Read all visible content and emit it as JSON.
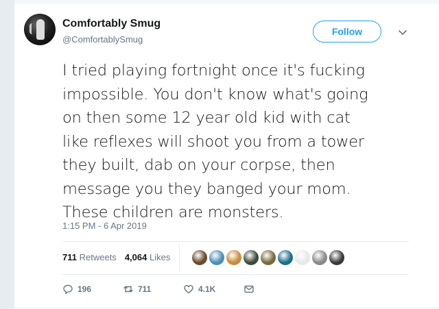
{
  "tweet": {
    "author": {
      "name": "Comfortably Smug",
      "handle": "@ComfortablySmug"
    },
    "follow_label": "Follow",
    "text_lines": [
      "I tried playing fortnight once it's fucking",
      "impossible. You don't know what's going",
      "on then some 12 year old kid with cat",
      "like reflexes will shoot you from a tower",
      "they built, dab on your corpse, then",
      "message you they banged your mom.",
      "These children are monsters."
    ],
    "timestamp": "1:15 PM - 6 Apr 2019",
    "stats": {
      "retweets_count": "711",
      "retweets_label": "Retweets",
      "likes_count": "4,064",
      "likes_label": "Likes"
    },
    "liker_avatar_colors": [
      "#6b4a2b",
      "#4a90b8",
      "#c98a3a",
      "#3c4a3a",
      "#7a6a3a",
      "#1d6f8a",
      "#e8e8e8",
      "#8a8a8a",
      "#3a3a3a"
    ],
    "actions": {
      "reply_count": "196",
      "retweet_count": "711",
      "like_count": "4.1K"
    }
  }
}
